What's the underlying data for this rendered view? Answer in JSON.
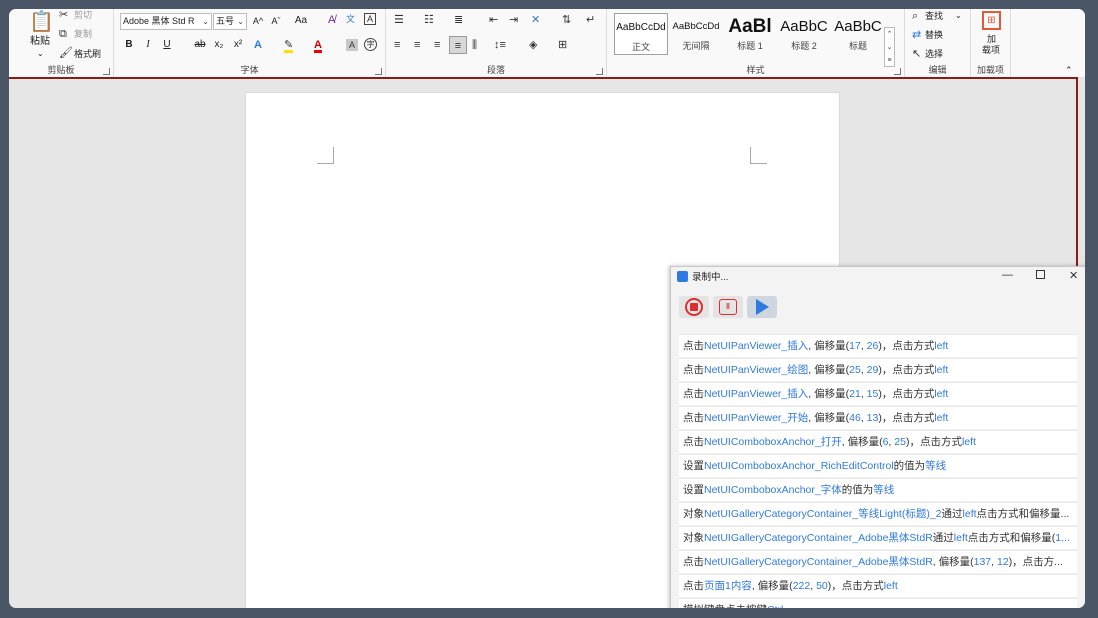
{
  "ribbon": {
    "clipboard": {
      "paste": "粘贴",
      "cut": "剪切",
      "copy": "复制",
      "painter": "格式刷",
      "label": "剪贴板"
    },
    "font": {
      "name": "Adobe 黑体 Std R",
      "size": "五号",
      "label": "字体",
      "bold": "B",
      "italic": "I",
      "underline": "U",
      "strike": "ab",
      "sub": "x₂",
      "sup": "x²",
      "grow": "A^",
      "shrink": "Aˇ",
      "case": "Aa",
      "phonetic": "文"
    },
    "paragraph": {
      "label": "段落"
    },
    "styles": {
      "label": "样式",
      "items": [
        {
          "preview": "AaBbCcDd",
          "name": "正文"
        },
        {
          "preview": "AaBbCcDd",
          "name": "无间隔"
        },
        {
          "preview": "AaBl",
          "name": "标题 1"
        },
        {
          "preview": "AaBbC",
          "name": "标题 2"
        },
        {
          "preview": "AaBbC",
          "name": "标题"
        }
      ]
    },
    "editing": {
      "find": "查找",
      "replace": "替换",
      "select": "选择",
      "label": "编辑"
    },
    "addins": {
      "line1": "加",
      "line2": "载项",
      "label": "加载项"
    }
  },
  "recorder": {
    "title": "录制中...",
    "rows": [
      [
        {
          "t": "点击"
        },
        {
          "t": "NetUIPanViewer_插入",
          "h": 1
        },
        {
          "t": ", 偏移量("
        },
        {
          "t": "17",
          "h": 1
        },
        {
          "t": ", "
        },
        {
          "t": "26",
          "h": 1
        },
        {
          "t": ")，点击方式"
        },
        {
          "t": "left",
          "h": 1
        }
      ],
      [
        {
          "t": "点击"
        },
        {
          "t": "NetUIPanViewer_绘图",
          "h": 1
        },
        {
          "t": ", 偏移量("
        },
        {
          "t": "25",
          "h": 1
        },
        {
          "t": ", "
        },
        {
          "t": "29",
          "h": 1
        },
        {
          "t": ")，点击方式"
        },
        {
          "t": "left",
          "h": 1
        }
      ],
      [
        {
          "t": "点击"
        },
        {
          "t": "NetUIPanViewer_插入",
          "h": 1
        },
        {
          "t": ", 偏移量("
        },
        {
          "t": "21",
          "h": 1
        },
        {
          "t": ", "
        },
        {
          "t": "15",
          "h": 1
        },
        {
          "t": ")，点击方式"
        },
        {
          "t": "left",
          "h": 1
        }
      ],
      [
        {
          "t": "点击"
        },
        {
          "t": "NetUIPanViewer_开始",
          "h": 1
        },
        {
          "t": ", 偏移量("
        },
        {
          "t": "46",
          "h": 1
        },
        {
          "t": ", "
        },
        {
          "t": "13",
          "h": 1
        },
        {
          "t": ")，点击方式"
        },
        {
          "t": "left",
          "h": 1
        }
      ],
      [
        {
          "t": "点击"
        },
        {
          "t": "NetUIComboboxAnchor_打开",
          "h": 1
        },
        {
          "t": ", 偏移量("
        },
        {
          "t": "6",
          "h": 1
        },
        {
          "t": ", "
        },
        {
          "t": "25",
          "h": 1
        },
        {
          "t": ")，点击方式"
        },
        {
          "t": "left",
          "h": 1
        }
      ],
      [
        {
          "t": "设置"
        },
        {
          "t": "NetUIComboboxAnchor_RichEditControl",
          "h": 1
        },
        {
          "t": "的值为"
        },
        {
          "t": "等线",
          "h": 1
        }
      ],
      [
        {
          "t": "设置"
        },
        {
          "t": "NetUIComboboxAnchor_字体",
          "h": 1
        },
        {
          "t": "的值为"
        },
        {
          "t": "等线",
          "h": 1
        }
      ],
      [
        {
          "t": "对象"
        },
        {
          "t": "NetUIGalleryCategoryContainer_等线Light(标题)_2",
          "h": 1
        },
        {
          "t": "通过"
        },
        {
          "t": "left",
          "h": 1
        },
        {
          "t": "点击方式和偏移量..."
        }
      ],
      [
        {
          "t": "对象"
        },
        {
          "t": "NetUIGalleryCategoryContainer_Adobe黑体StdR",
          "h": 1
        },
        {
          "t": "通过"
        },
        {
          "t": "left",
          "h": 1
        },
        {
          "t": "点击方式和偏移量("
        },
        {
          "t": "1...",
          "h": 1
        }
      ],
      [
        {
          "t": "点击"
        },
        {
          "t": "NetUIGalleryCategoryContainer_Adobe黑体StdR",
          "h": 1
        },
        {
          "t": ", 偏移量("
        },
        {
          "t": "137",
          "h": 1
        },
        {
          "t": ", "
        },
        {
          "t": "12",
          "h": 1
        },
        {
          "t": ")，点击方..."
        }
      ],
      [
        {
          "t": "点击"
        },
        {
          "t": "页面1内容",
          "h": 1
        },
        {
          "t": ", 偏移量("
        },
        {
          "t": "222",
          "h": 1
        },
        {
          "t": ", "
        },
        {
          "t": "50",
          "h": 1
        },
        {
          "t": ")，点击方式"
        },
        {
          "t": "left",
          "h": 1
        }
      ],
      [
        {
          "t": "模拟键盘点击按键"
        },
        {
          "t": "Ctrl",
          "h": 1
        }
      ]
    ]
  }
}
